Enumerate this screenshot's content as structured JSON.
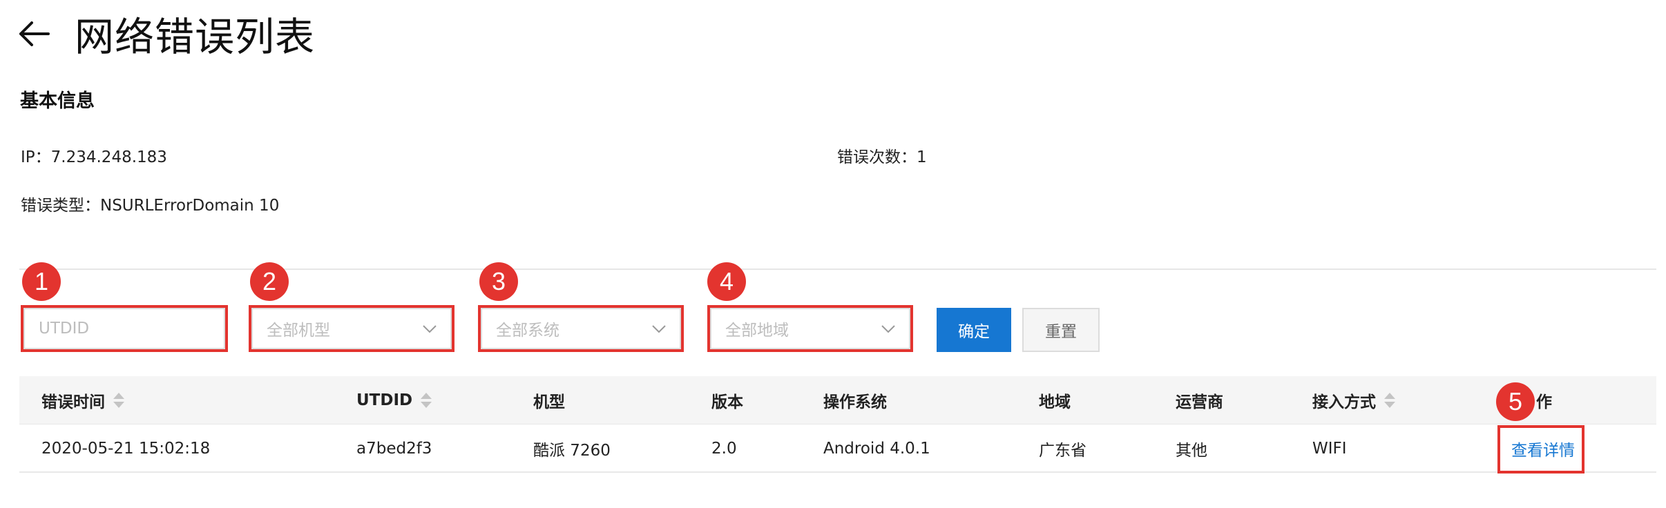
{
  "header": {
    "title": "网络错误列表",
    "back_icon": "arrow-left-icon"
  },
  "basic_info": {
    "section_title": "基本信息",
    "ip": "IP：7.234.248.183",
    "error_count": "错误次数：1",
    "error_type": "错误类型：NSURLErrorDomain 10"
  },
  "filters": {
    "utdid_placeholder": "UTDID",
    "model_select": "全部机型",
    "os_select": "全部系统",
    "region_select": "全部地域",
    "confirm_label": "确定",
    "reset_label": "重置"
  },
  "annotations": {
    "badge_1": "1",
    "badge_2": "2",
    "badge_3": "3",
    "badge_4": "4",
    "badge_5": "5",
    "color": "#e3342f"
  },
  "table": {
    "headers": {
      "error_time": "错误时间",
      "utdid": "UTDID",
      "model": "机型",
      "version": "版本",
      "os": "操作系统",
      "region": "地域",
      "carrier": "运营商",
      "access": "接入方式",
      "action": "作"
    },
    "rows": [
      {
        "error_time": "2020-05-21 15:02:18",
        "utdid": "a7bed2f3",
        "model": "酷派 7260",
        "version": "2.0",
        "os": "Android 4.0.1",
        "region": "广东省",
        "carrier": "其他",
        "access": "WIFI",
        "action": "查看详情"
      }
    ]
  },
  "colors": {
    "primary": "#1677d2",
    "highlight": "#e3342f"
  }
}
